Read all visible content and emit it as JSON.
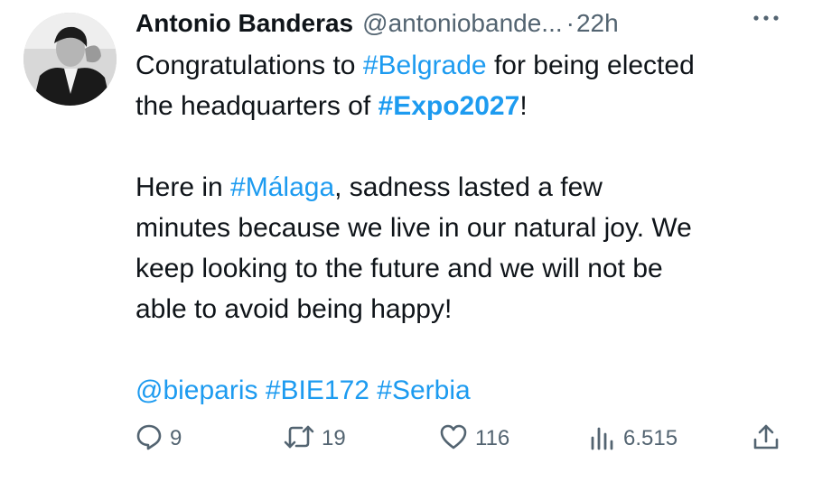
{
  "tweet": {
    "author": {
      "display_name": "Antonio Banderas",
      "handle": "@antoniobande...",
      "separator": "·",
      "time": "22h"
    },
    "lines": [
      [
        {
          "t": "text",
          "v": "Congratulations to "
        },
        {
          "t": "tag",
          "v": "#Belgrade"
        },
        {
          "t": "text",
          "v": " for being elected"
        }
      ],
      [
        {
          "t": "text",
          "v": "the headquarters of "
        },
        {
          "t": "tagb",
          "v": "#Expo2027"
        },
        {
          "t": "text",
          "v": "!"
        }
      ],
      [],
      [
        {
          "t": "text",
          "v": "Here in "
        },
        {
          "t": "tag",
          "v": "#Málaga"
        },
        {
          "t": "text",
          "v": ", sadness lasted a few"
        }
      ],
      [
        {
          "t": "text",
          "v": "minutes because we live in our natural joy. We"
        }
      ],
      [
        {
          "t": "text",
          "v": "keep looking to the future and we will not be"
        }
      ],
      [
        {
          "t": "text",
          "v": "able to avoid being happy!"
        }
      ],
      [],
      [
        {
          "t": "tag",
          "v": "@bieparis"
        },
        {
          "t": "text",
          "v": " "
        },
        {
          "t": "tag",
          "v": "#BIE172"
        },
        {
          "t": "text",
          "v": " "
        },
        {
          "t": "tag",
          "v": "#Serbia"
        }
      ]
    ],
    "actions": {
      "replies": "9",
      "retweets": "19",
      "likes": "116",
      "views": "6.515"
    }
  },
  "colors": {
    "link": "#1d9bf0",
    "text": "#0f1419",
    "muted": "#536471"
  },
  "icons": [
    "more-icon",
    "reply-icon",
    "retweet-icon",
    "like-icon",
    "views-icon",
    "share-icon"
  ]
}
